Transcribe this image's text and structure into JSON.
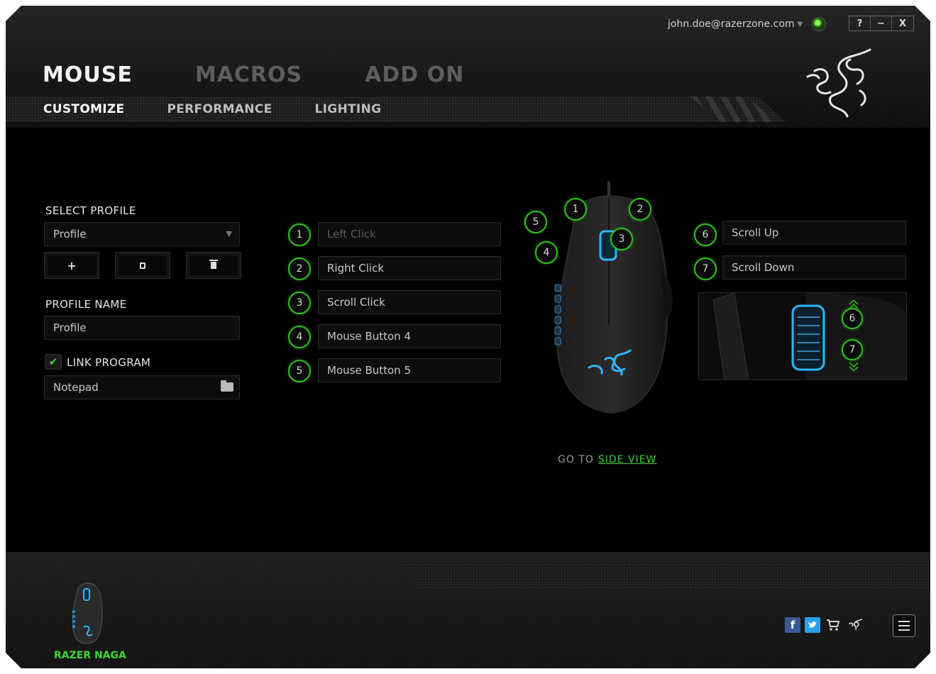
{
  "header": {
    "user_email": "john.doe@razerzone.com",
    "window_controls": [
      "?",
      "−",
      "X"
    ],
    "main_tabs": [
      {
        "label": "MOUSE",
        "active": true
      },
      {
        "label": "MACROS",
        "active": false
      },
      {
        "label": "ADD ON",
        "active": false
      }
    ],
    "sub_tabs": [
      {
        "label": "CUSTOMIZE",
        "active": true
      },
      {
        "label": "PERFORMANCE",
        "active": false
      },
      {
        "label": "LIGHTING",
        "active": false
      }
    ],
    "logo": "razer-snake-logo"
  },
  "profile_panel": {
    "select_profile_label": "SELECT PROFILE",
    "selected_profile": "Profile",
    "buttons": {
      "add": "+",
      "copy": "copy-icon",
      "delete": "trash-icon"
    },
    "profile_name_label": "PROFILE NAME",
    "profile_name_value": "Profile",
    "link_program_label": "LINK PROGRAM",
    "link_program_checked": true,
    "linked_program": "Notepad"
  },
  "buttons_left": [
    {
      "num": "1",
      "label": "Left Click",
      "dim": true
    },
    {
      "num": "2",
      "label": "Right Click",
      "dim": false
    },
    {
      "num": "3",
      "label": "Scroll Click",
      "dim": false
    },
    {
      "num": "4",
      "label": "Mouse Button 4",
      "dim": false
    },
    {
      "num": "5",
      "label": "Mouse Button 5",
      "dim": false
    }
  ],
  "buttons_right": [
    {
      "num": "6",
      "label": "Scroll Up"
    },
    {
      "num": "7",
      "label": "Scroll Down"
    }
  ],
  "mouse_diagram_badges": [
    "1",
    "2",
    "3",
    "4",
    "5"
  ],
  "scroll_preview_badges": [
    "6",
    "7"
  ],
  "goto": {
    "prefix": "GO TO",
    "link": "SIDE VIEW"
  },
  "footer": {
    "device_name": "RAZER NAGA",
    "social_icons": [
      "facebook-icon",
      "twitter-icon",
      "cart-icon",
      "razer-icon"
    ]
  },
  "colors": {
    "accent_green": "#3dd636",
    "glow_blue": "#2fb6ff",
    "background": "#000000"
  }
}
